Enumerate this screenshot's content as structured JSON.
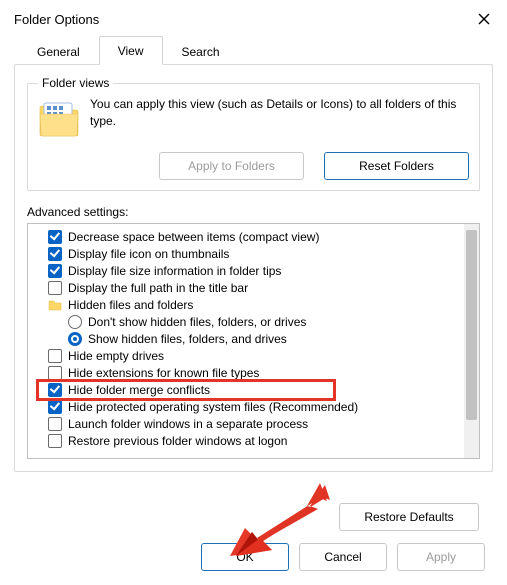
{
  "window": {
    "title": "Folder Options"
  },
  "tabs": {
    "general": "General",
    "view": "View",
    "search": "Search"
  },
  "folder_views": {
    "group_title": "Folder views",
    "desc": "You can apply this view (such as Details or Icons) to all folders of this type.",
    "apply": "Apply to Folders",
    "reset": "Reset Folders"
  },
  "advanced_label": "Advanced settings:",
  "settings": {
    "decrease_space": "Decrease space between items (compact view)",
    "display_icon_thumb": "Display file icon on thumbnails",
    "display_size_tips": "Display file size information in folder tips",
    "display_full_path": "Display the full path in the title bar",
    "hidden_folder_label": "Hidden files and folders",
    "dont_show_hidden": "Don't show hidden files, folders, or drives",
    "show_hidden": "Show hidden files, folders, and drives",
    "hide_empty": "Hide empty drives",
    "hide_ext": "Hide extensions for known file types",
    "hide_merge": "Hide folder merge conflicts",
    "hide_protected": "Hide protected operating system files (Recommended)",
    "launch_separate": "Launch folder windows in a separate process",
    "restore_prev": "Restore previous folder windows at logon"
  },
  "buttons": {
    "restore_defaults": "Restore Defaults",
    "ok": "OK",
    "cancel": "Cancel",
    "apply": "Apply"
  }
}
